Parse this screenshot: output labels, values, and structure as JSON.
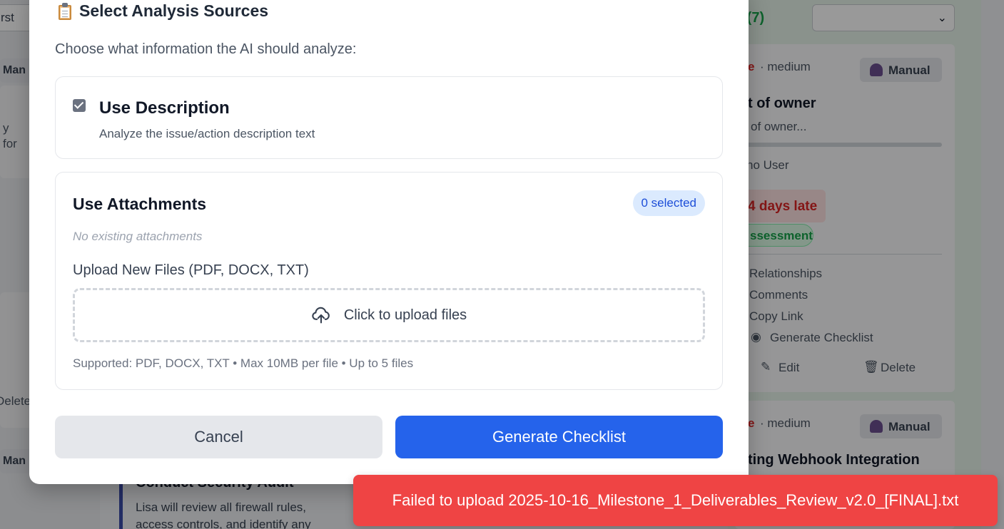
{
  "background": {
    "left_sort_value": "rst",
    "left_chip_label": "Man",
    "left_card_fragment_1": "y",
    "left_card_fragment_2": "for",
    "left_delete_fragment": "Delete",
    "left_chip_label_2": "Man",
    "right_column_title": "e (7)",
    "card1": {
      "priority_fragment": "e",
      "severity": "· medium",
      "source_label": "Manual",
      "title_fragment": "t of owner",
      "desc_fragment": "of owner...",
      "user_fragment": "no User",
      "late_label": "4 days late",
      "type_fragment": "ssessment",
      "menu": [
        "Relationships",
        "Comments",
        "Copy Link",
        "Generate Checklist"
      ],
      "edit_label": "Edit",
      "delete_label": "Delete"
    },
    "card2": {
      "priority_fragment": "e",
      "severity": "· medium",
      "source_label": "Manual",
      "title_fragment": "ting Webhook Integration"
    },
    "task": {
      "title": "Conduct Security Audit",
      "desc_line1": "Lisa will review all firewall rules,",
      "desc_line2": "access controls, and identify any"
    }
  },
  "modal": {
    "title": "Select Analysis Sources",
    "icon": "clipboard-icon",
    "subtitle": "Choose what information the AI should analyze:",
    "description_option": {
      "title": "Use Description",
      "desc": "Analyze the issue/action description text",
      "checked": true
    },
    "attachments": {
      "title": "Use Attachments",
      "selected_badge": "0 selected",
      "empty_text": "No existing attachments",
      "upload_label": "Upload New Files (PDF, DOCX, TXT)",
      "upload_button": "Click to upload files",
      "supported_text": "Supported: PDF, DOCX, TXT • Max 10MB per file • Up to 5 files"
    },
    "cancel_label": "Cancel",
    "generate_label": "Generate Checklist"
  },
  "toast": {
    "message": "Failed to upload 2025-10-16_Milestone_1_Deliverables_Review_v2.0_[FINAL].txt",
    "color": "#ef4444"
  }
}
